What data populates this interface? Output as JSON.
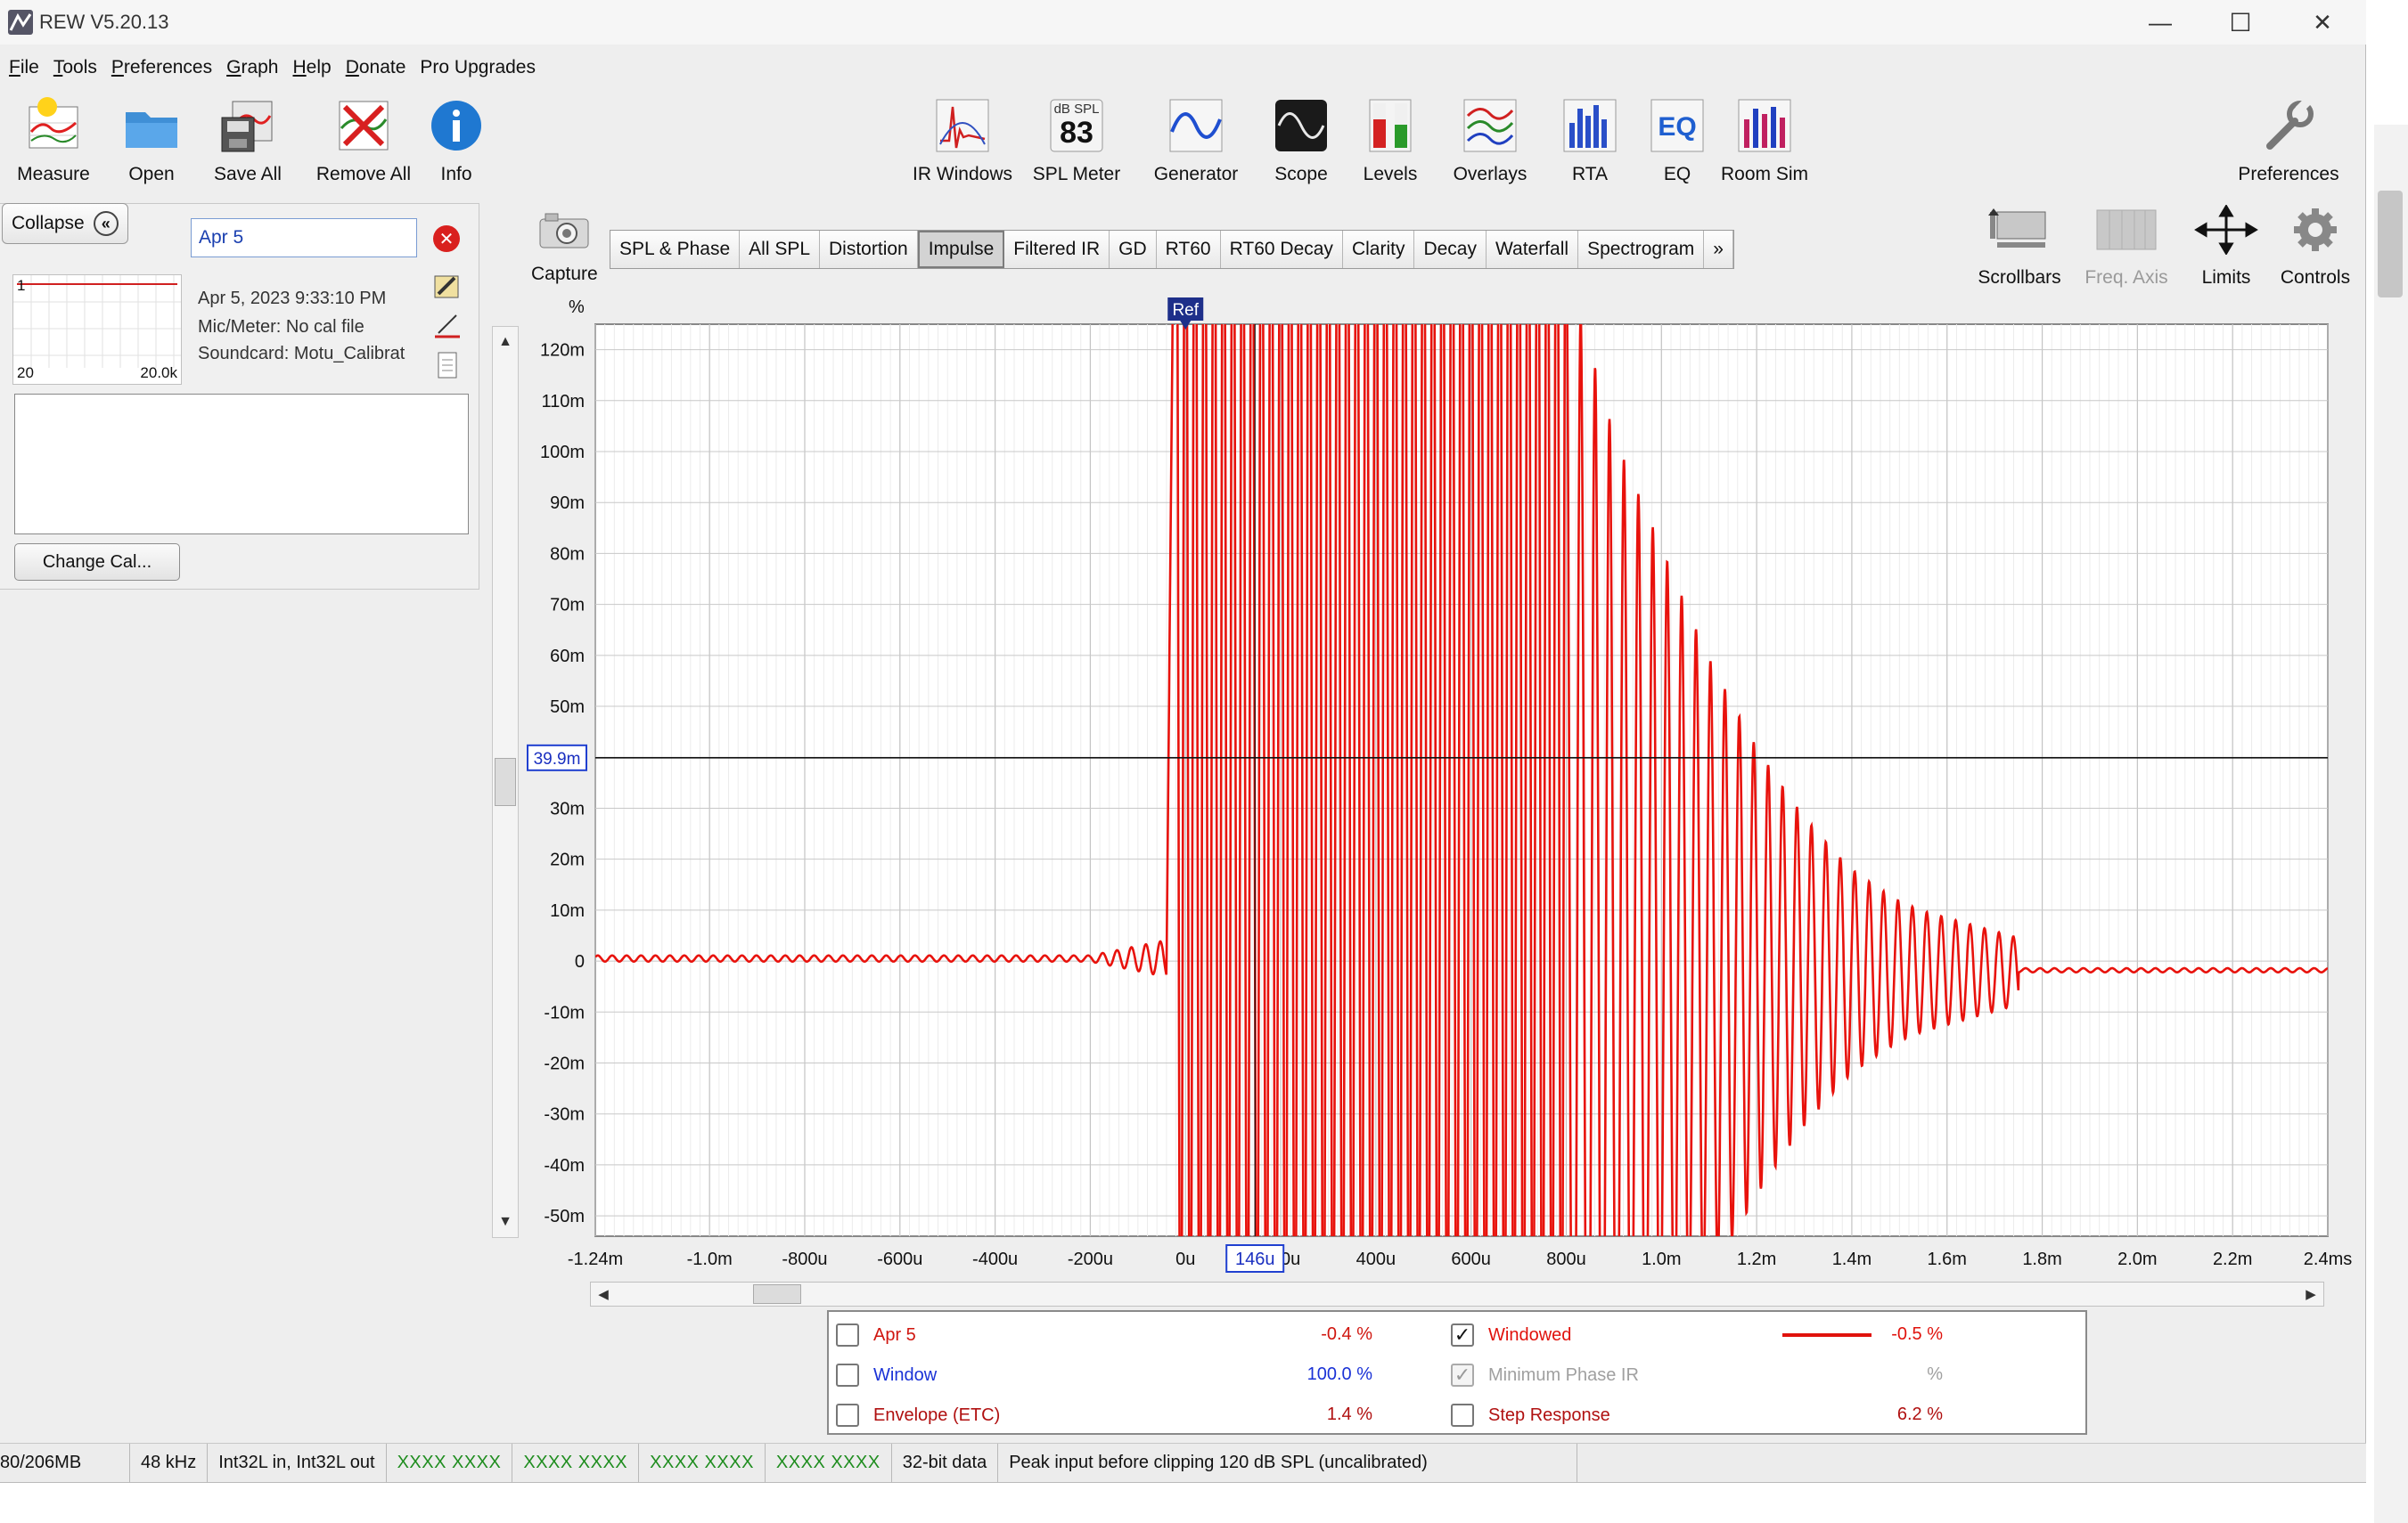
{
  "window": {
    "title": "REW V5.20.13",
    "controls": {
      "minimize": "—",
      "maximize": "☐",
      "close": "✕"
    }
  },
  "menu": [
    {
      "label": "File",
      "key": "F"
    },
    {
      "label": "Tools",
      "key": "T"
    },
    {
      "label": "Preferences",
      "key": "P"
    },
    {
      "label": "Graph",
      "key": "G"
    },
    {
      "label": "Help",
      "key": "H"
    },
    {
      "label": "Donate",
      "key": "D"
    },
    {
      "label": "Pro Upgrades",
      "key": ""
    }
  ],
  "toolbar_left": [
    "Measure",
    "Open",
    "Save All",
    "Remove All",
    "Info"
  ],
  "toolbar_center": [
    "IR Windows",
    "SPL Meter",
    "Generator",
    "Scope",
    "Levels",
    "Overlays",
    "RTA",
    "EQ",
    "Room Sim"
  ],
  "toolbar_right": {
    "preferences": "Preferences"
  },
  "spl_meter_icon": {
    "unit": "dB SPL",
    "value": "83"
  },
  "panel": {
    "collapse_label": "Collapse",
    "measurement_name": "Apr 5",
    "thumb_index": "1",
    "thumb_xmin": "20",
    "thumb_xmax": "20.0k",
    "date": "Apr 5, 2023 9:33:10 PM",
    "mic": "Mic/Meter: No cal file",
    "soundcard": "Soundcard: Motu_Calibrat",
    "change_cal": "Change Cal..."
  },
  "capture_label": "Capture",
  "tabs": [
    {
      "label": "SPL & Phase",
      "active": false
    },
    {
      "label": "All SPL",
      "active": false
    },
    {
      "label": "Distortion",
      "active": false
    },
    {
      "label": "Impulse",
      "active": true
    },
    {
      "label": "Filtered IR",
      "active": false
    },
    {
      "label": "GD",
      "active": false
    },
    {
      "label": "RT60",
      "active": false
    },
    {
      "label": "RT60 Decay",
      "active": false
    },
    {
      "label": "Clarity",
      "active": false
    },
    {
      "label": "Decay",
      "active": false
    },
    {
      "label": "Waterfall",
      "active": false
    },
    {
      "label": "Spectrogram",
      "active": false
    },
    {
      "label": "»",
      "active": false
    }
  ],
  "right_tools": [
    "Scrollbars",
    "Freq. Axis",
    "Limits",
    "Controls"
  ],
  "graph": {
    "y_unit": "%",
    "y_ticks": [
      "120m",
      "110m",
      "100m",
      "90m",
      "80m",
      "70m",
      "60m",
      "50m",
      "40m",
      "30m",
      "20m",
      "10m",
      "0",
      "-10m",
      "-20m",
      "-30m",
      "-40m",
      "-50m"
    ],
    "x_ticks": [
      "-1.24m",
      "-1.0m",
      "-800u",
      "-600u",
      "-400u",
      "-200u",
      "0u",
      "200u",
      "400u",
      "600u",
      "800u",
      "1.0m",
      "1.2m",
      "1.4m",
      "1.6m",
      "1.8m",
      "2.0m",
      "2.2m",
      "2.4ms"
    ],
    "ref_marker": "Ref",
    "cursor_y_label": "39.9m",
    "cursor_x_label": "146u",
    "trace_color": "#e8120c"
  },
  "chart_data": {
    "type": "line",
    "title": "",
    "xlabel": "",
    "ylabel": "%",
    "xlim": [
      -1.24,
      2.4
    ],
    "ylim": [
      -0.054,
      0.125
    ],
    "x_unit": "ms",
    "grid": true,
    "series": [
      {
        "color": "#e8120c",
        "points": [
          [
            -1.24,
            0.0
          ],
          [
            -0.2,
            0.0
          ],
          [
            -0.1,
            0.008
          ],
          [
            -0.05,
            -0.003
          ],
          [
            -0.03,
            0.125
          ],
          [
            0.0,
            0.125
          ],
          [
            0.2,
            0.125
          ],
          [
            0.4,
            0.125
          ],
          [
            0.6,
            0.125
          ],
          [
            0.75,
            0.125
          ],
          [
            0.8,
            0.11
          ],
          [
            0.9,
            0.085
          ],
          [
            1.0,
            0.07
          ],
          [
            1.1,
            0.052
          ],
          [
            1.2,
            0.036
          ],
          [
            1.3,
            0.022
          ],
          [
            1.4,
            0.01
          ],
          [
            1.5,
            0.003
          ],
          [
            1.6,
            0.0
          ],
          [
            1.8,
            -0.002
          ],
          [
            2.0,
            -0.002
          ],
          [
            2.4,
            -0.002
          ]
        ]
      }
    ],
    "cursor": {
      "x": 0.146,
      "y": 0.0399
    },
    "reference_x": 0.0
  },
  "legend": {
    "left": [
      {
        "label": "Apr 5",
        "value": "-0.4 %",
        "color": "#d0160f",
        "checked": false
      },
      {
        "label": "Window",
        "value": "100.0 %",
        "color": "#1a32d6",
        "checked": false
      },
      {
        "label": "Envelope (ETC)",
        "value": "1.4 %",
        "color": "#b01010",
        "checked": false
      }
    ],
    "right": [
      {
        "label": "Windowed",
        "value": "-0.5 %",
        "color": "#e0120c",
        "checked": true,
        "disabled": false,
        "line": true
      },
      {
        "label": "Minimum Phase IR",
        "value": "%",
        "color": "#a0a0a0",
        "checked": true,
        "disabled": true,
        "line": false
      },
      {
        "label": "Step Response",
        "value": "6.2 %",
        "color": "#b01010",
        "checked": false,
        "disabled": false,
        "line": false
      }
    ]
  },
  "status": {
    "memory": "80/206MB",
    "rate": "48 kHz",
    "format": "Int32L in, Int32L out",
    "xo1": "XXXX XXXX",
    "xo2": "XXXX XXXX",
    "xo3": "XXXX XXXX",
    "xo4": "XXXX XXXX",
    "bits": "32-bit data",
    "peak": "Peak input before clipping 120 dB SPL (uncalibrated)"
  }
}
